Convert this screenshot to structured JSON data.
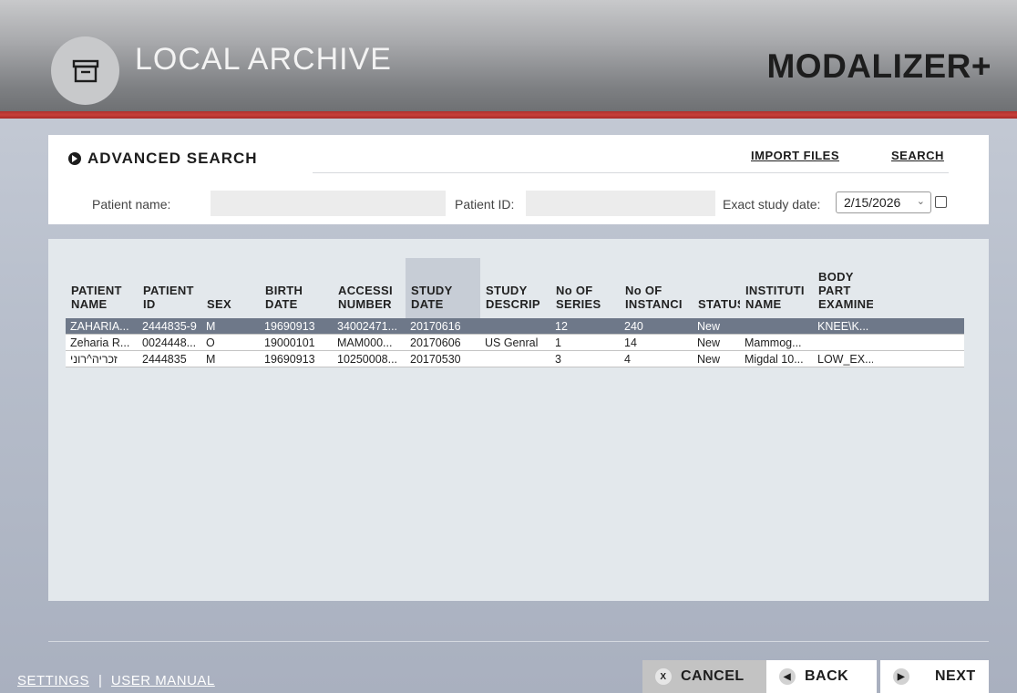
{
  "header": {
    "app_title": "LOCAL ARCHIVE",
    "brand": "MODALIZER+"
  },
  "search": {
    "title": "ADVANCED SEARCH",
    "import_label": "IMPORT FILES",
    "search_label": "SEARCH",
    "patient_name_label": "Patient name:",
    "patient_name_value": "",
    "patient_id_label": "Patient ID:",
    "patient_id_value": "",
    "study_date_label": "Exact study date:",
    "study_date_value": "2/15/2026",
    "exact_date_checked": false
  },
  "table": {
    "columns": [
      {
        "label": "PATIENT\nNAME"
      },
      {
        "label": "PATIENT\nID"
      },
      {
        "label": "SEX"
      },
      {
        "label": "BIRTH\nDATE"
      },
      {
        "label": "ACCESSI\nNUMBER"
      },
      {
        "label": "STUDY\nDATE"
      },
      {
        "label": "STUDY\nDESCRIP"
      },
      {
        "label": "No OF\nSERIES"
      },
      {
        "label": "No OF\nINSTANCI"
      },
      {
        "label": "STATUS"
      },
      {
        "label": "INSTITUTI\nNAME"
      },
      {
        "label": "BODY\nPART\nEXAMINE"
      }
    ],
    "rows": [
      {
        "selected": true,
        "cells": [
          "ZAHARIA...",
          "2444835-9",
          "M",
          "19690913",
          "34002471...",
          "20170616",
          "",
          "12",
          "240",
          "New",
          "",
          "KNEE\\K..."
        ]
      },
      {
        "selected": false,
        "cells": [
          "Zeharia R...",
          "0024448...",
          "O",
          "19000101",
          "MAM000...",
          "20170606",
          "US Genral",
          "1",
          "14",
          "New",
          "Mammog...",
          ""
        ]
      },
      {
        "selected": false,
        "cells": [
          "זכריה^רוני",
          "2444835",
          "M",
          "19690913",
          "10250008...",
          "20170530",
          "",
          "3",
          "4",
          "New",
          "Migdal 10...",
          "LOW_EX..."
        ]
      }
    ]
  },
  "footer": {
    "settings_label": "SETTINGS",
    "separator": "|",
    "manual_label": "USER MANUAL",
    "cancel_label": "CANCEL",
    "back_label": "BACK",
    "next_label": "NEXT"
  }
}
